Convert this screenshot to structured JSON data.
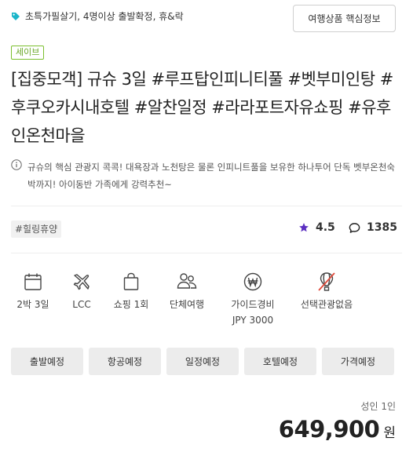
{
  "header": {
    "tags": "초특가필살기, 4명이상 출발확정, 휴&락",
    "info_button": "여행상품 핵심정보"
  },
  "badge": "세이브",
  "title": "[집중모객] 규슈 3일 #루프탑인피니티풀 #벳부미인탕 #후쿠오카시내호텔 #알찬일정 #라라포트자유쇼핑 #유후인온천마을",
  "description": "규슈의 핵심 관광지 콕콕! 대욕장과 노천탕은 물론 인피니트풀을 보유한 하나투어 단독 벳부온천숙박까지! 아이동반 가족에게 강력추천~",
  "hashtag": "#힐링휴양",
  "rating": "4.5",
  "review_count": "1385",
  "features": [
    {
      "icon": "calendar-icon",
      "label": "2박 3일"
    },
    {
      "icon": "airplane-icon",
      "label": "LCC"
    },
    {
      "icon": "shopping-bag-icon",
      "label": "쇼핑 1회"
    },
    {
      "icon": "group-icon",
      "label": "단체여행"
    },
    {
      "icon": "won-coin-icon",
      "label": "가이드경비\nJPY 3000"
    },
    {
      "icon": "balloon-crossed-icon",
      "label": "선택관광없음"
    }
  ],
  "tabs": [
    "출발예정",
    "항공예정",
    "일정예정",
    "호텔예정",
    "가격예정"
  ],
  "price": {
    "pax": "성인 1인",
    "amount": "649,900",
    "unit": "원"
  },
  "colors": {
    "tag_icon": "#1bb5c9",
    "badge": "#6aa828",
    "star": "#5b2fc1"
  }
}
